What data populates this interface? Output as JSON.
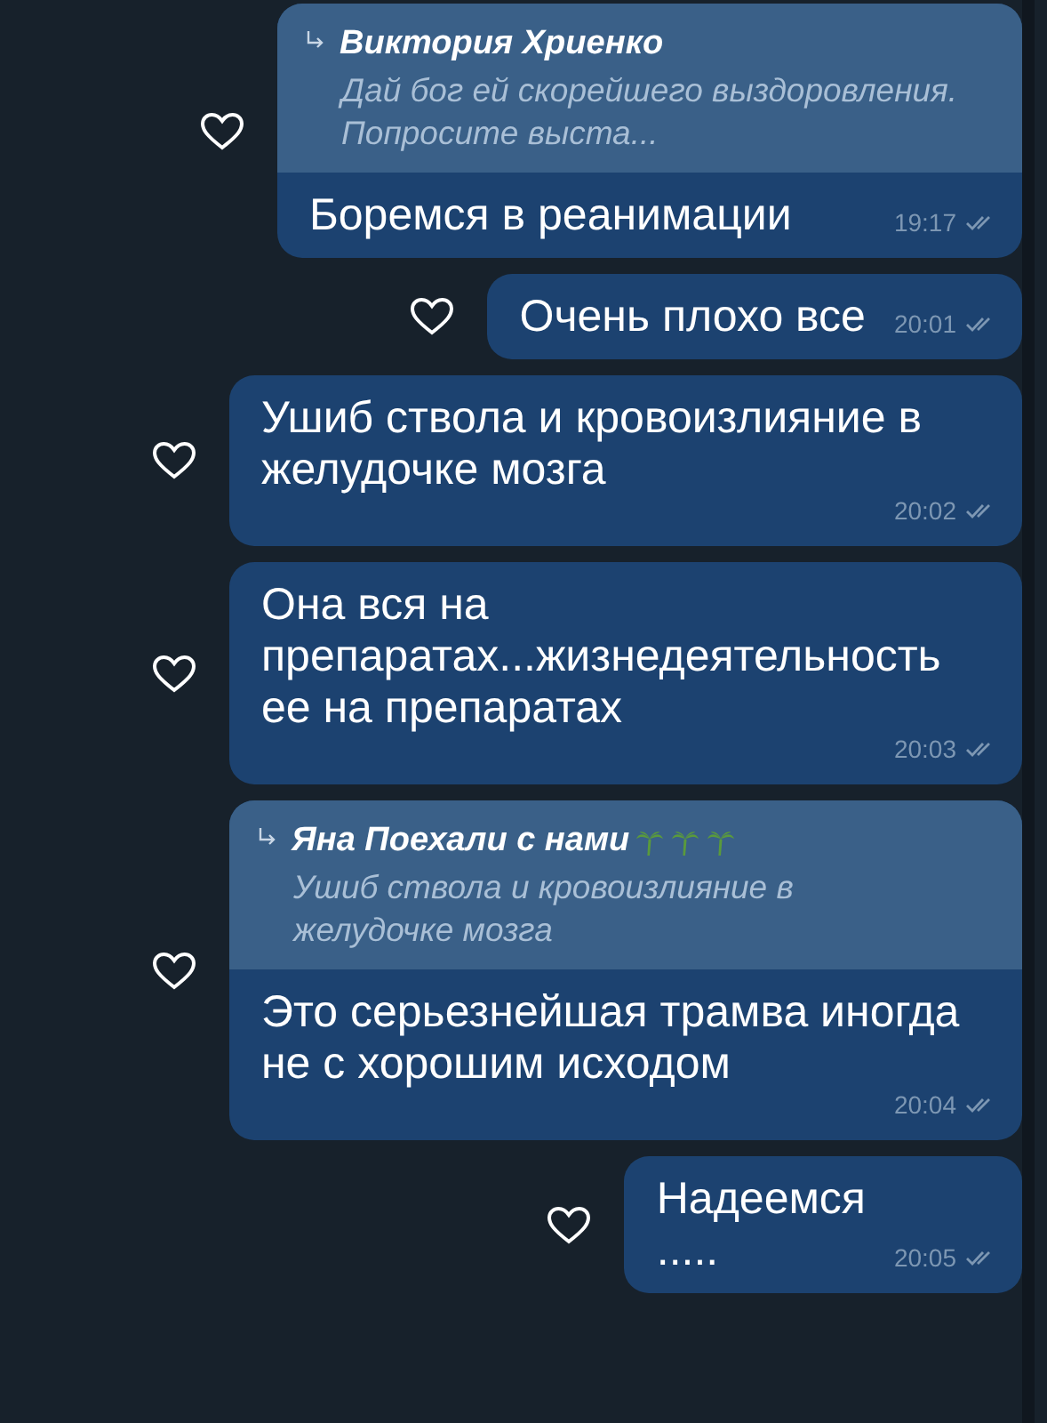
{
  "messages": [
    {
      "reply": {
        "author": "Виктория Хриенко",
        "text": "Дай бог ей скорейшего выздоровления. Попросите выста..."
      },
      "text": "Боремся в реанимации",
      "time": "19:17",
      "read": true,
      "liked": false
    },
    {
      "text": "Очень плохо все",
      "time": "20:01",
      "read": true,
      "liked": false
    },
    {
      "text": "Ушиб ствола и кровоизлияние в желудочке мозга",
      "time": "20:02",
      "read": true,
      "liked": false
    },
    {
      "text": "Она вся на препаратах...жизнедеятельность ее на препаратах",
      "time": "20:03",
      "read": true,
      "liked": false
    },
    {
      "reply": {
        "author": "Яна Поехали с нами",
        "text": "Ушиб ствола и кровоизлияние в желудочке мозга",
        "author_icons": [
          {
            "kind": "palm"
          },
          {
            "kind": "palm"
          },
          {
            "kind": "palm"
          }
        ]
      },
      "text": "Это серьезнейшая трамва иногда не с хорошим исходом",
      "time": "20:04",
      "read": true,
      "liked": false
    },
    {
      "text": "Надеемся\n.....",
      "time": "20:05",
      "read": true,
      "liked": false
    }
  ]
}
